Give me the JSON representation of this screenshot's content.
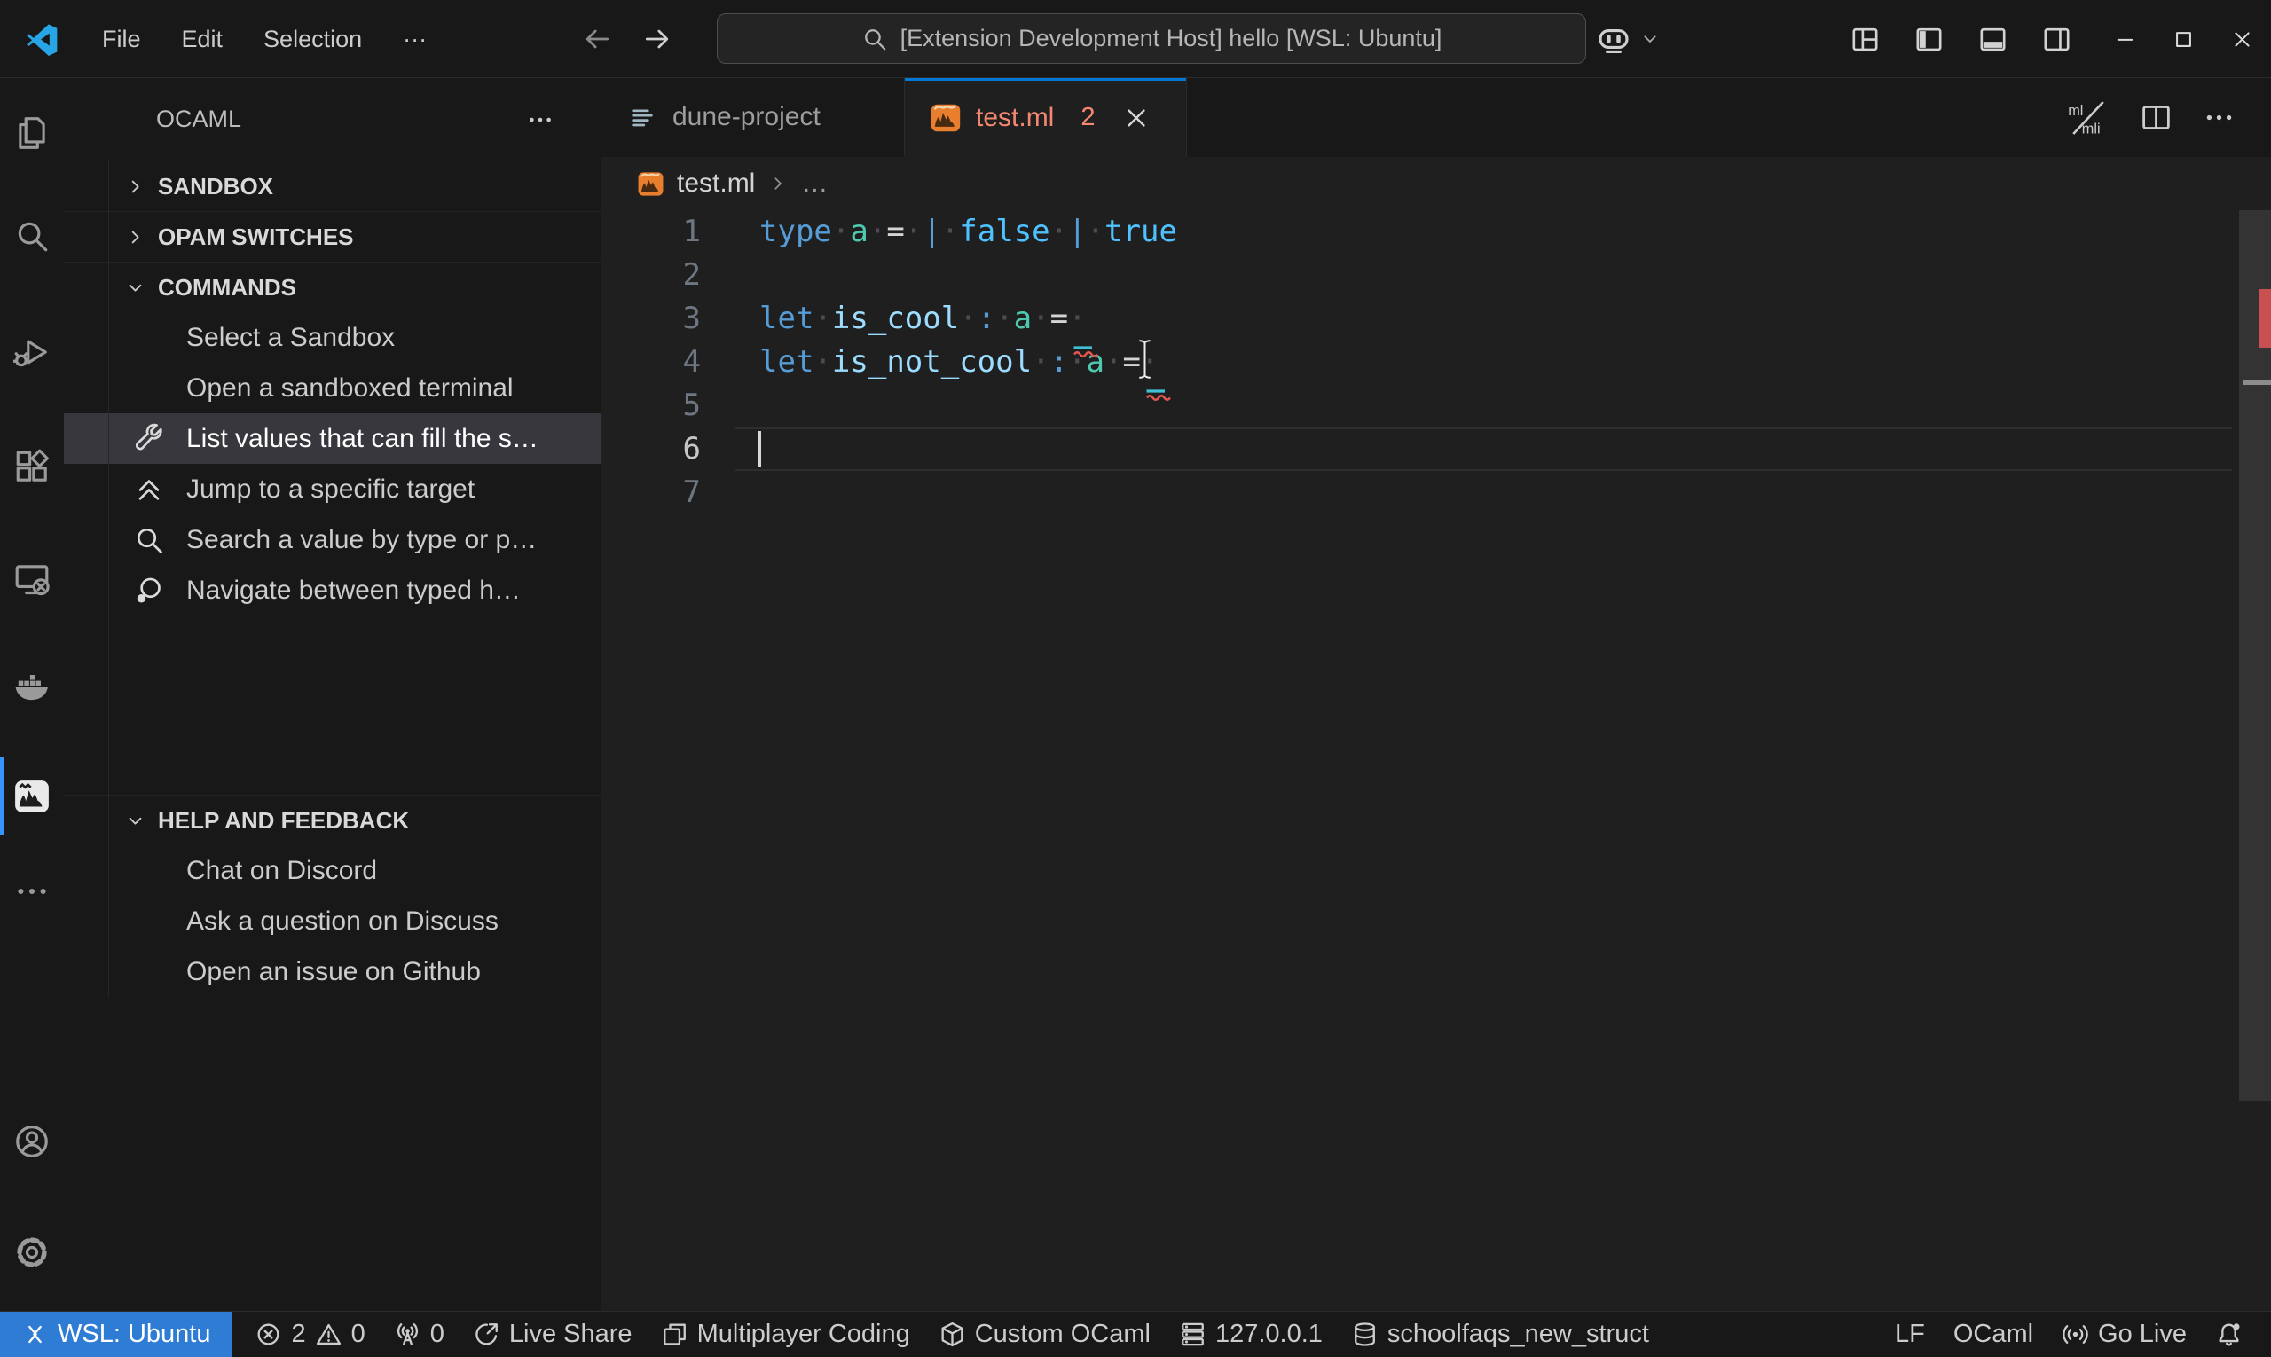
{
  "window": {
    "title_menus": [
      "File",
      "Edit",
      "Selection",
      "···"
    ],
    "command_center": {
      "text": "[Extension Development Host] hello [WSL: Ubuntu]"
    },
    "right_icons": [
      "copilot",
      "chevron-down"
    ],
    "layout_icons": [
      "layout",
      "layout-sidebar-left",
      "layout-panel",
      "layout-sidebar-right"
    ],
    "controls": [
      "minimize",
      "maximize",
      "close"
    ]
  },
  "activity_bar": {
    "top": [
      {
        "name": "explorer",
        "icon": "files"
      },
      {
        "name": "search",
        "icon": "search"
      },
      {
        "name": "run-debug",
        "icon": "debug"
      },
      {
        "name": "extensions",
        "icon": "extensions"
      },
      {
        "name": "remote-explorer",
        "icon": "remote-explorer"
      },
      {
        "name": "docker",
        "icon": "docker"
      },
      {
        "name": "ocaml",
        "icon": "ocaml-platform",
        "active": true
      },
      {
        "name": "more",
        "icon": "ellipsis"
      }
    ],
    "bottom": [
      {
        "name": "accounts",
        "icon": "account"
      },
      {
        "name": "settings",
        "icon": "gear"
      }
    ]
  },
  "sidebar": {
    "title": "OCAML",
    "sections": [
      {
        "id": "sandbox",
        "label": "SANDBOX",
        "collapsed": true,
        "items": []
      },
      {
        "id": "opam-switches",
        "label": "OPAM SWITCHES",
        "collapsed": true,
        "items": []
      },
      {
        "id": "commands",
        "label": "COMMANDS",
        "collapsed": false,
        "items": [
          {
            "label": "Select a Sandbox"
          },
          {
            "label": "Open a sandboxed terminal"
          },
          {
            "label": "List values that can fill the s…",
            "icon": "tools",
            "selected": true
          },
          {
            "label": "Jump to a specific target",
            "icon": "double-chevron-up"
          },
          {
            "label": "Search a value by type or p…",
            "icon": "search"
          },
          {
            "label": "Navigate between typed h…",
            "icon": "inspect"
          }
        ]
      },
      {
        "id": "help-and-feedback",
        "label": "HELP AND FEEDBACK",
        "collapsed": false,
        "items": [
          {
            "label": "Chat on Discord"
          },
          {
            "label": "Ask a question on Discuss"
          },
          {
            "label": "Open an issue on Github"
          }
        ]
      }
    ]
  },
  "editor": {
    "tabs": [
      {
        "label": "dune-project",
        "icon": "dune-file",
        "active": false
      },
      {
        "label": "test.ml",
        "icon": "ocaml-file",
        "badge": "2",
        "active": true,
        "has_close": true
      }
    ],
    "ml_mli_labels": [
      "ml",
      "mli"
    ],
    "actions": [
      {
        "name": "ml-mli-switch",
        "icon": "mlmli"
      },
      {
        "name": "split-editor",
        "icon": "split"
      },
      {
        "name": "more-actions",
        "icon": "ellipsis"
      }
    ],
    "breadcrumb": {
      "file": "test.ml",
      "more": "…"
    },
    "code": {
      "lines": [
        {
          "n": "1",
          "tokens": [
            [
              "type",
              "kw"
            ],
            [
              "·",
              "ws"
            ],
            [
              "a",
              "ty"
            ],
            [
              "·",
              "ws"
            ],
            [
              "=",
              "op"
            ],
            [
              "·",
              "ws"
            ],
            [
              "|",
              "kw"
            ],
            [
              "·",
              "ws"
            ],
            [
              "false",
              "cn"
            ],
            [
              "·",
              "ws"
            ],
            [
              "|",
              "kw"
            ],
            [
              "·",
              "ws"
            ],
            [
              "true",
              "cn"
            ]
          ]
        },
        {
          "n": "2",
          "tokens": []
        },
        {
          "n": "3",
          "tokens": [
            [
              "let",
              "kw"
            ],
            [
              "·",
              "ws"
            ],
            [
              "is_cool",
              "var"
            ],
            [
              "·",
              "ws"
            ],
            [
              ":",
              "kw"
            ],
            [
              "·",
              "ws"
            ],
            [
              "a",
              "ty"
            ],
            [
              "·",
              "ws"
            ],
            [
              "=",
              "op"
            ],
            [
              "·",
              "ws"
            ]
          ]
        },
        {
          "n": "4",
          "tokens": [
            [
              "let",
              "kw"
            ],
            [
              "·",
              "ws"
            ],
            [
              "is_not_cool",
              "var"
            ],
            [
              "·",
              "ws"
            ],
            [
              ":",
              "kw"
            ],
            [
              "·",
              "ws"
            ],
            [
              "a",
              "ty"
            ],
            [
              "·",
              "ws"
            ],
            [
              "=",
              "op"
            ],
            [
              "·",
              "ws"
            ]
          ]
        },
        {
          "n": "5",
          "tokens": []
        },
        {
          "n": "6",
          "tokens": [],
          "current": true
        },
        {
          "n": "7",
          "tokens": []
        }
      ],
      "cursor": {
        "line": 6,
        "col": 0
      },
      "error_marks": [
        {
          "line": 3,
          "col": 18
        },
        {
          "line": 4,
          "col": 22
        }
      ]
    }
  },
  "status_bar": {
    "left": [
      {
        "name": "remote",
        "style": "remote",
        "parts": [
          {
            "icon": "remote"
          },
          {
            "text": "WSL: Ubuntu"
          }
        ]
      },
      {
        "name": "problems",
        "parts": [
          {
            "icon": "error"
          },
          {
            "text": "2"
          },
          {
            "icon": "warning"
          },
          {
            "text": "0"
          }
        ]
      },
      {
        "name": "ports",
        "parts": [
          {
            "icon": "radio-tower"
          },
          {
            "text": "0"
          }
        ]
      },
      {
        "name": "live-share",
        "parts": [
          {
            "icon": "live-share"
          },
          {
            "text": "Live Share"
          }
        ]
      },
      {
        "name": "multiplayer-coding",
        "parts": [
          {
            "icon": "windows"
          },
          {
            "text": "Multiplayer Coding"
          }
        ]
      },
      {
        "name": "custom-ocaml",
        "parts": [
          {
            "icon": "package"
          },
          {
            "text": "Custom OCaml"
          }
        ]
      },
      {
        "name": "server-address",
        "parts": [
          {
            "icon": "server"
          },
          {
            "text": "127.0.0.1"
          }
        ]
      },
      {
        "name": "database",
        "parts": [
          {
            "icon": "database"
          },
          {
            "text": "schoolfaqs_new_struct"
          }
        ]
      }
    ],
    "right": [
      {
        "name": "eol",
        "parts": [
          {
            "text": "LF"
          }
        ]
      },
      {
        "name": "language-mode",
        "parts": [
          {
            "text": "OCaml"
          }
        ]
      },
      {
        "name": "go-live",
        "parts": [
          {
            "icon": "broadcast"
          },
          {
            "text": "Go Live"
          }
        ]
      },
      {
        "name": "notifications",
        "parts": [
          {
            "icon": "bell-dot"
          }
        ]
      }
    ]
  },
  "colors": {
    "bg": "#1f1f1f",
    "bg2": "#181818",
    "border": "#2b2b2b",
    "fg": "#cccccc",
    "accent": "#0078d4",
    "remoteBg": "#2f7cd4",
    "selection": "#37373d",
    "tabError": "#f48771",
    "camel": "#e97f2e",
    "kw": "#569cd6",
    "ty": "#4ec9b0",
    "varc": "#9cdcfe",
    "op": "#d4d4d4",
    "cn": "#4fc1ff",
    "ws": "#4b4b52",
    "lineNo": "#6e7681",
    "lineNoActive": "#c6c6c6",
    "errRed": "#e4574e",
    "holeTeal": "#41c0d4"
  }
}
